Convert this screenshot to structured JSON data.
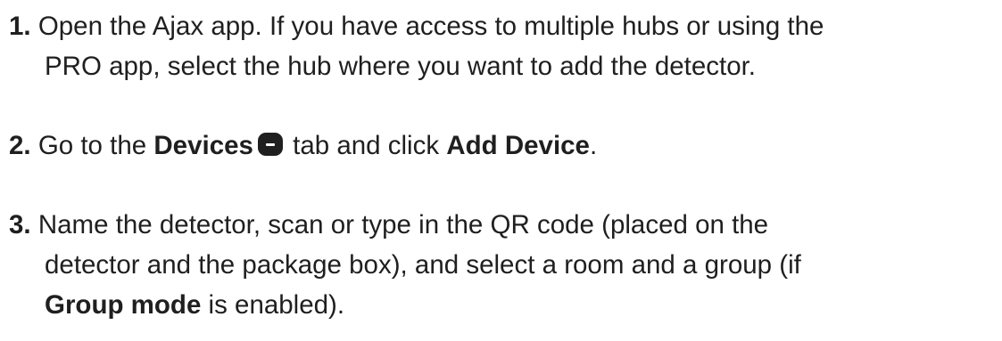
{
  "steps": [
    {
      "number": "1.",
      "line1": "Open the Ajax app. If you have access to multiple hubs or using the",
      "line2": "PRO app, select the hub where you want to add the detector."
    },
    {
      "number": "2.",
      "pre": "Go to the ",
      "devices_label": "Devices",
      "icon": "devices-tab-icon",
      "mid": " tab and click ",
      "add_device_label": "Add Device",
      "end": "."
    },
    {
      "number": "3.",
      "line1": "Name the detector, scan or type in the QR code (placed on the",
      "line2": "detector and the package box), and select a room and a group (if",
      "group_mode_label": "Group mode",
      "line3_end": " is enabled)."
    }
  ]
}
